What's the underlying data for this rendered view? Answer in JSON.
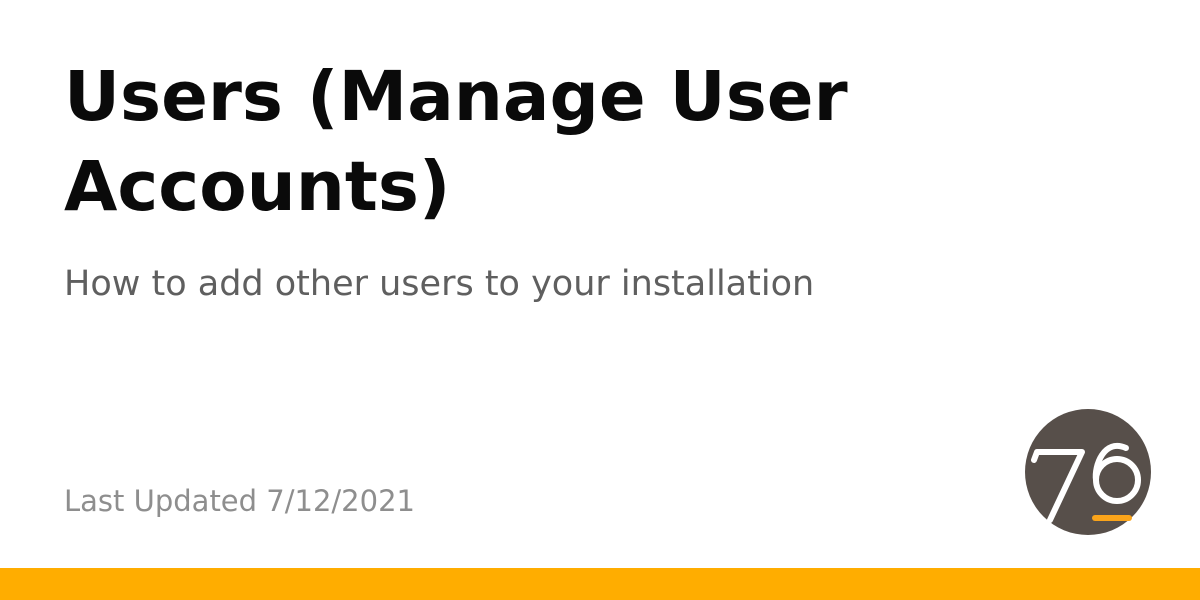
{
  "page": {
    "title": "Users (Manage User Accounts)",
    "subtitle": "How to add other users to your installation",
    "last_updated": "Last Updated 7/12/2021"
  },
  "logo": {
    "text": "76",
    "icon": "system76-logo",
    "circle_color": "#574F4A",
    "mark_color": "#FFFFFF",
    "underline_color": "#FAA41A"
  },
  "footer": {
    "bar_color": "#FFAD00"
  },
  "colors": {
    "background": "#FFFFFF",
    "title": "#0A0A0A",
    "subtitle": "#5F5F5F",
    "muted": "#8E8E8E"
  }
}
